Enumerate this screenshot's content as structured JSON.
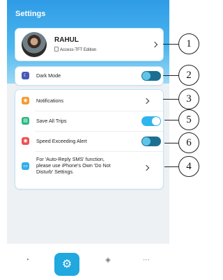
{
  "header": {
    "title": "Settings"
  },
  "profile": {
    "name": "RAHUL",
    "edition": "Access-TFT Edition"
  },
  "dark_mode": {
    "label": "Dark Mode",
    "state": "off"
  },
  "settings": {
    "notifications": {
      "label": "Notifications"
    },
    "save_trips": {
      "label": "Save All Trips",
      "state": "on"
    },
    "speed_alert": {
      "label": "Speed Exceeding Alert",
      "state": "off"
    },
    "auto_reply": {
      "line1": "For 'Auto-Reply SMS' function,",
      "line2": "please use iPhone's Own 'Do Not",
      "line3": "Disturb' Settings."
    }
  },
  "callouts": [
    "1",
    "2",
    "3",
    "4",
    "5",
    "6"
  ],
  "nav": {
    "items": [
      "speedometer-icon",
      "settings-icon",
      "navigation-icon",
      "more-icon"
    ]
  },
  "colors": {
    "accent": "#20a8df",
    "header_top": "#2f9be6",
    "toggle_on": "#2fb5ec",
    "notification_icon": "#f59a32",
    "trip_icon": "#26b77f",
    "speed_icon": "#ef4f4f",
    "message_icon": "#31aee6",
    "dark_icon": "#4759b5"
  }
}
